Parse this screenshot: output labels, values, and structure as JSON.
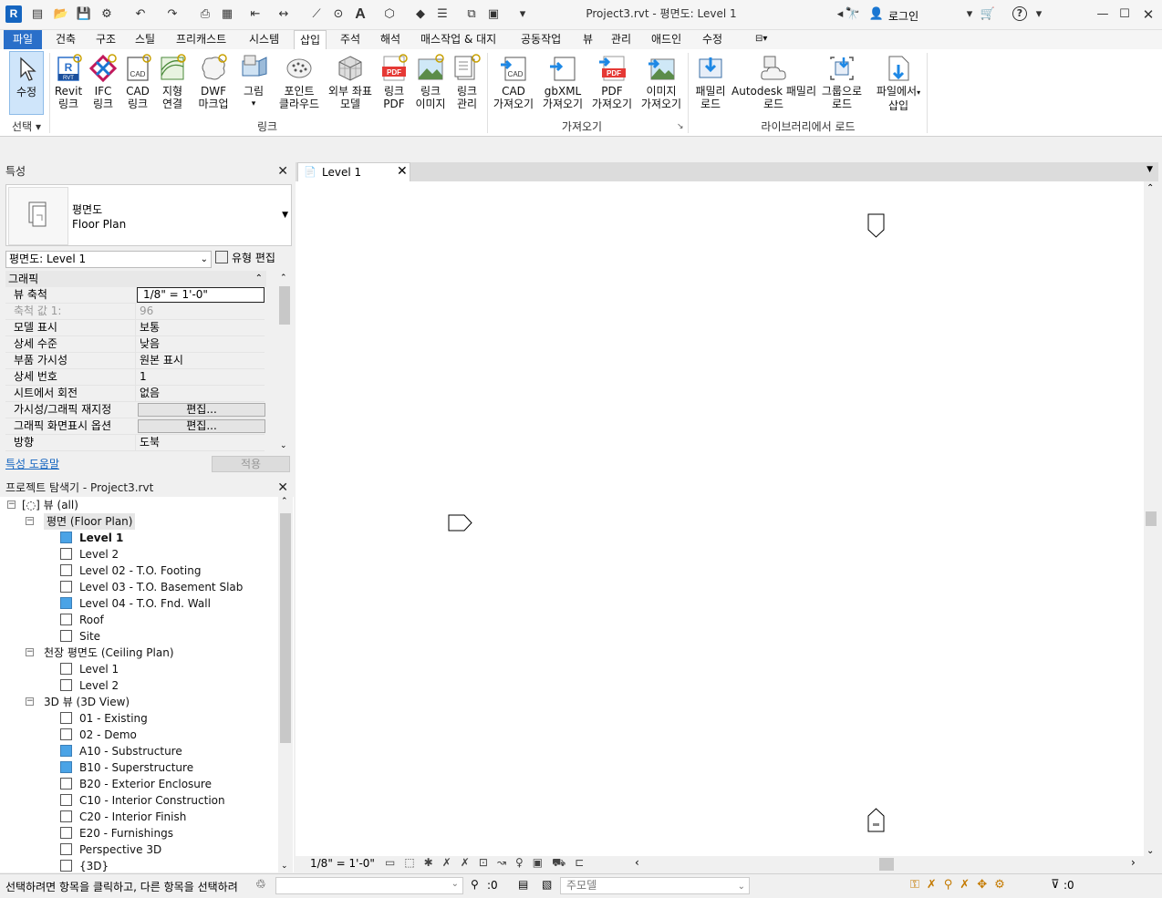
{
  "titlebar": {
    "app_letter": "R",
    "title": "Project3.rvt - 평면도: Level 1",
    "login": "로그인"
  },
  "menu": {
    "tabs": [
      "파일",
      "건축",
      "구조",
      "스틸",
      "프리캐스트",
      "시스템",
      "삽입",
      "주석",
      "해석",
      "매스작업 & 대지",
      "공동작업",
      "뷰",
      "관리",
      "애드인",
      "수정"
    ],
    "active_tab": "삽입"
  },
  "ribbon": {
    "select": {
      "modify": "수정",
      "group": "선택"
    },
    "link_buttons": [
      {
        "l1": "Revit",
        "l2": "링크"
      },
      {
        "l1": "IFC",
        "l2": "링크"
      },
      {
        "l1": "CAD",
        "l2": "링크"
      },
      {
        "l1": "지형",
        "l2": "연결"
      },
      {
        "l1": "DWF",
        "l2": "마크업"
      },
      {
        "l1": "그림",
        "l2": ""
      },
      {
        "l1": "포인트",
        "l2": "클라우드"
      },
      {
        "l1": "외부 좌표",
        "l2": "모델"
      },
      {
        "l1": "링크",
        "l2": "PDF"
      },
      {
        "l1": "링크",
        "l2": "이미지"
      },
      {
        "l1": "링크",
        "l2": "관리"
      }
    ],
    "link_group": "링크",
    "import_buttons": [
      {
        "l1": "CAD",
        "l2": "가져오기"
      },
      {
        "l1": "gbXML",
        "l2": "가져오기"
      },
      {
        "l1": "PDF",
        "l2": "가져오기"
      },
      {
        "l1": "이미지",
        "l2": "가져오기"
      }
    ],
    "import_group": "가져오기",
    "library_buttons": [
      {
        "l1": "패밀리",
        "l2": "로드"
      },
      {
        "l1": "Autodesk 패밀리",
        "l2": "로드"
      },
      {
        "l1": "그룹으로",
        "l2": "로드"
      },
      {
        "l1": "파일에서",
        "l2": "삽입"
      }
    ],
    "library_group": "라이브러리에서 로드",
    "icon_text": {
      "rvt": "RVT",
      "cad": "CAD",
      "pdf": "PDF"
    }
  },
  "properties": {
    "title": "특성",
    "type_name_ko": "평면도",
    "type_name_en": "Floor Plan",
    "view_selector": "평면도: Level 1",
    "edit_type": "유형 편집",
    "section": "그래픽",
    "rows": [
      {
        "k": "뷰 축척",
        "v": "1/8\" = 1'-0\""
      },
      {
        "k": "축척 값    1:",
        "v": "96"
      },
      {
        "k": "모델 표시",
        "v": "보통"
      },
      {
        "k": "상세 수준",
        "v": "낮음"
      },
      {
        "k": "부품 가시성",
        "v": "원본 표시"
      },
      {
        "k": "상세 번호",
        "v": "1"
      },
      {
        "k": "시트에서 회전",
        "v": "없음"
      },
      {
        "k": "가시성/그래픽 재지정",
        "v": "편집..."
      },
      {
        "k": "그래픽 화면표시 옵션",
        "v": "편집..."
      },
      {
        "k": "방향",
        "v": "도북"
      }
    ],
    "help_link": "특성 도움말",
    "apply": "적용"
  },
  "browser": {
    "title": "프로젝트 탐색기 - Project3.rvt",
    "root": "뷰 (all)",
    "groups": [
      {
        "label": "평면 (Floor Plan)",
        "items": [
          {
            "t": "Level 1",
            "on": true,
            "bold": true
          },
          {
            "t": "Level 2",
            "on": false
          },
          {
            "t": "Level 02 - T.O. Footing",
            "on": false
          },
          {
            "t": "Level 03 - T.O. Basement Slab",
            "on": false
          },
          {
            "t": "Level 04 - T.O. Fnd. Wall",
            "on": true
          },
          {
            "t": "Roof",
            "on": false
          },
          {
            "t": "Site",
            "on": false
          }
        ]
      },
      {
        "label": "천장 평면도 (Ceiling Plan)",
        "items": [
          {
            "t": "Level 1",
            "on": false
          },
          {
            "t": "Level 2",
            "on": false
          }
        ]
      },
      {
        "label": "3D 뷰 (3D View)",
        "items": [
          {
            "t": "01 - Existing",
            "on": false
          },
          {
            "t": "02 - Demo",
            "on": false
          },
          {
            "t": "A10 - Substructure",
            "on": true
          },
          {
            "t": "B10 - Superstructure",
            "on": true
          },
          {
            "t": "B20 - Exterior Enclosure",
            "on": false
          },
          {
            "t": "C10 - Interior Construction",
            "on": false
          },
          {
            "t": "C20 - Interior Finish",
            "on": false
          },
          {
            "t": "E20 - Furnishings",
            "on": false
          },
          {
            "t": "Perspective 3D",
            "on": false
          },
          {
            "t": "{3D}",
            "on": false
          }
        ]
      }
    ]
  },
  "view": {
    "tab": "Level 1",
    "scale": "1/8\" = 1'-0\""
  },
  "status": {
    "hint": "선택하려면 항목을 클릭하고, 다른 항목을 선택하려",
    "workset_count": ":0",
    "model": "주모델",
    "filter_count": ":0"
  }
}
